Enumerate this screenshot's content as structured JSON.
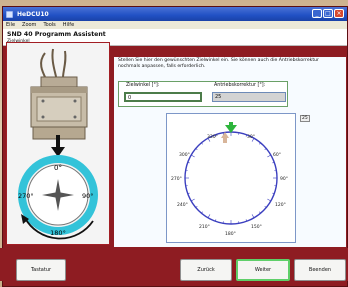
{
  "window": {
    "title": "HeDCU10",
    "controls": [
      "_",
      "□",
      "×"
    ]
  },
  "menu": [
    "Eile",
    "Zoom",
    "Tools",
    "Hilfe"
  ],
  "header": {
    "title": "SND 40 Programm Assistent",
    "subtitle": "Zielwinkel"
  },
  "instructions": "Stellen Sie hier den gewünschten Zielwinkel ein. Sie können auch die Antriebskorrektur nochmals anpassen, falls erforderlich.",
  "fields": {
    "target_angle_label": "Zielwinkel [°]:",
    "target_angle_value": "0",
    "drive_correction_label": "Antriebskorrektur [°]:",
    "drive_correction_value": "25"
  },
  "dial": {
    "labels": [
      "330°",
      "30°",
      "300°",
      "60°",
      "270°",
      "90°",
      "240°",
      "120°",
      "210°",
      "150°",
      "180°"
    ],
    "target_marker_color": "#2db53c",
    "correction_marker_color": "#d8b59a",
    "circle_color": "#3b3fbf"
  },
  "small_indicator": "25",
  "left_image": {
    "labels": [
      "0°",
      "270°",
      "90°",
      "180°"
    ],
    "ring_color": "#33c3d9"
  },
  "buttons": {
    "keyboard": "Tastatur",
    "back": "Zurück",
    "next": "Weiter",
    "finish": "Beenden"
  }
}
